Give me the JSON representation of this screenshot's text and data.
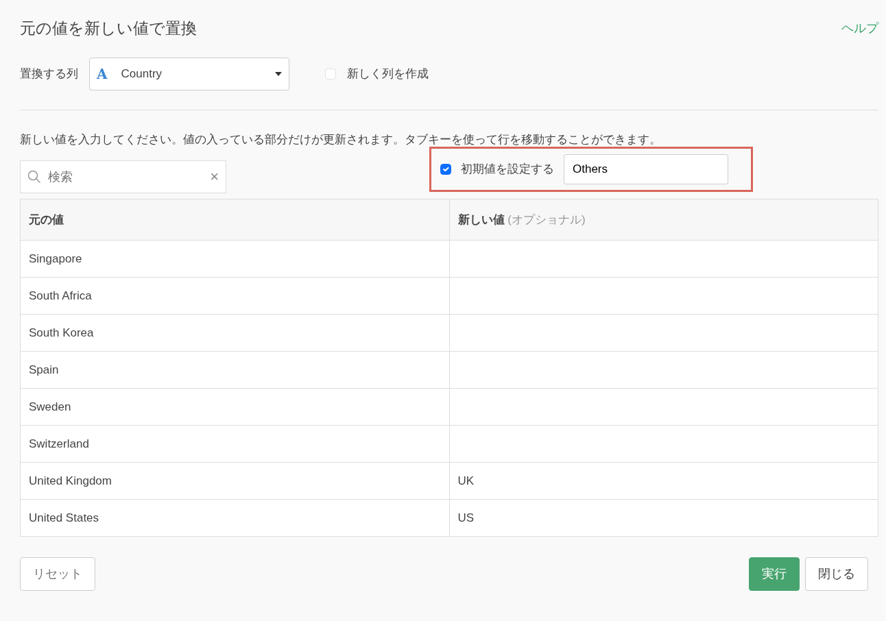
{
  "title": "元の値を新しい値で置換",
  "help_link": "ヘルプ",
  "column_select": {
    "label": "置換する列",
    "value": "Country",
    "type_icon": "A"
  },
  "create_new_column": {
    "label": "新しく列を作成",
    "checked": false
  },
  "instruction": "新しい値を入力してください。値の入っている部分だけが更新されます。タブキーを使って行を移動することができます。",
  "search": {
    "placeholder": "検索",
    "clear": "×"
  },
  "default_value": {
    "label": "初期値を設定する",
    "checked": true,
    "value": "Others",
    "highlighted": true
  },
  "table": {
    "columns": [
      {
        "label": "元の値"
      },
      {
        "label": "新しい値",
        "note": "(オプショナル)"
      }
    ],
    "rows": [
      {
        "original": "Singapore",
        "new": ""
      },
      {
        "original": "South Africa",
        "new": ""
      },
      {
        "original": "South Korea",
        "new": ""
      },
      {
        "original": "Spain",
        "new": ""
      },
      {
        "original": "Sweden",
        "new": ""
      },
      {
        "original": "Switzerland",
        "new": ""
      },
      {
        "original": "United Kingdom",
        "new": "UK"
      },
      {
        "original": "United States",
        "new": "US"
      }
    ]
  },
  "buttons": {
    "reset": "リセット",
    "run": "実行",
    "close": "閉じる"
  }
}
